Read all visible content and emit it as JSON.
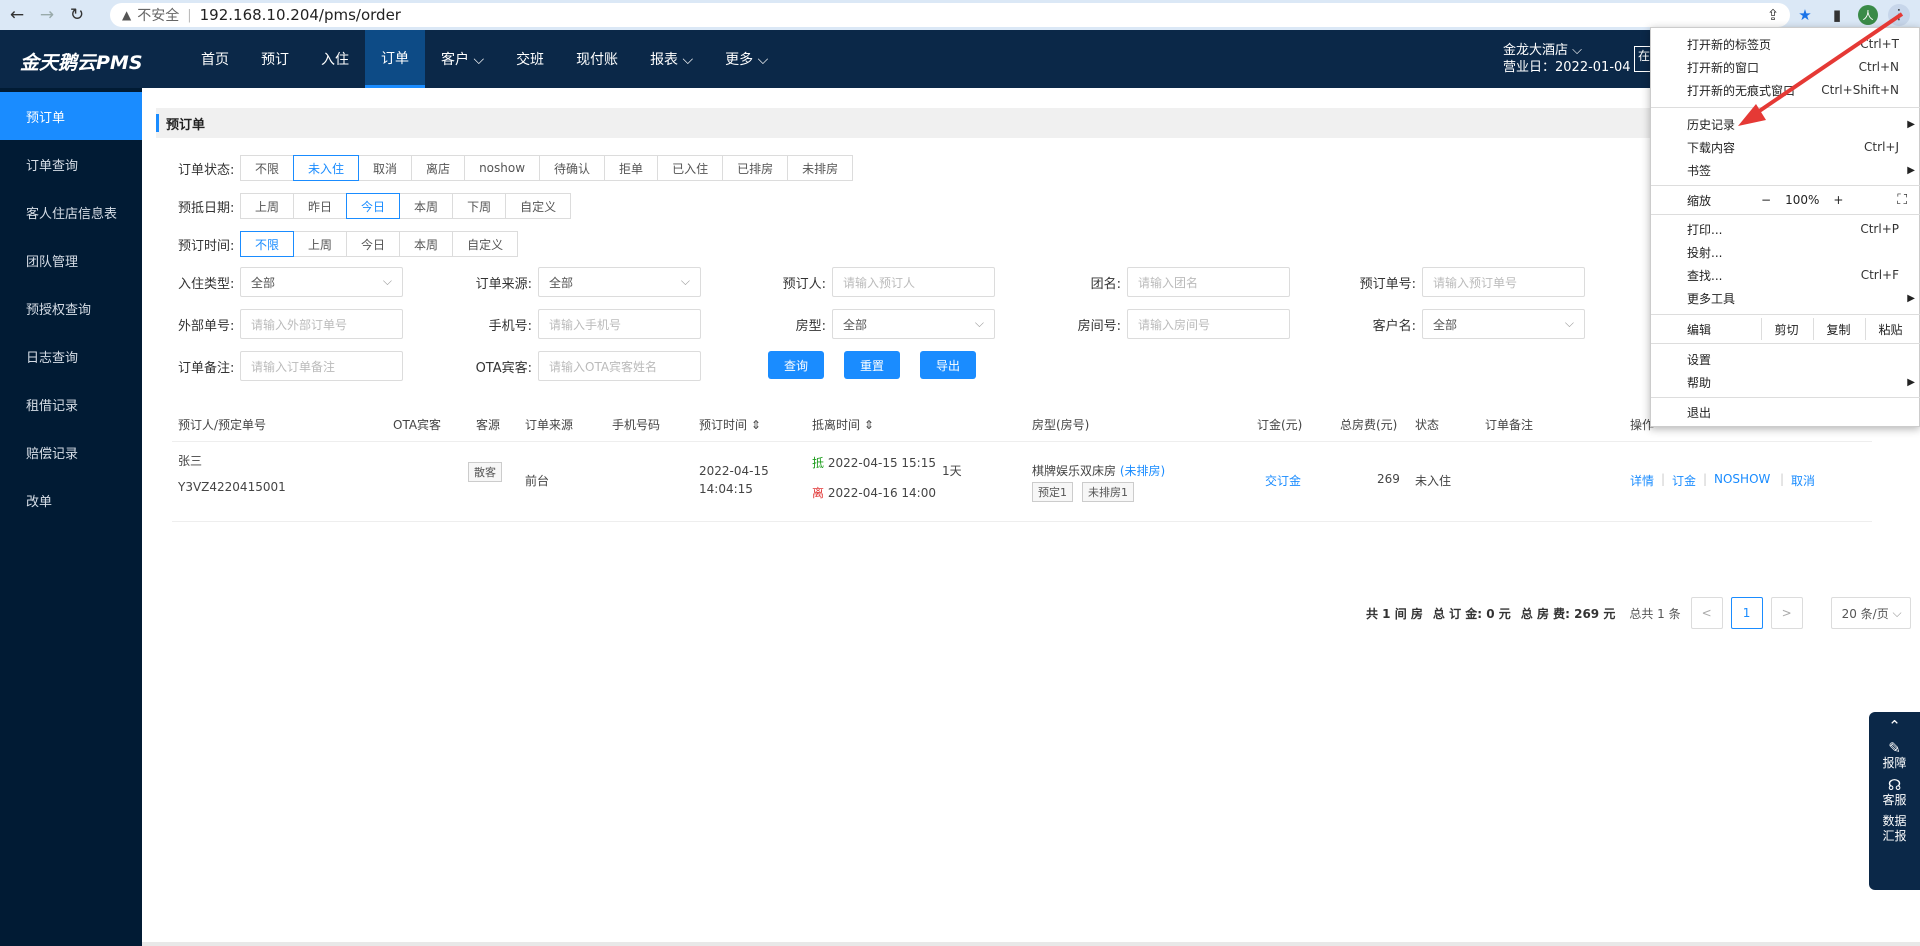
{
  "browser": {
    "insecure_label": "不安全",
    "url": "192.168.10.204/pms/order",
    "avatar": "人"
  },
  "app": {
    "brand": "金天鹅云PMS",
    "nav": [
      {
        "label": "首页"
      },
      {
        "label": "预订"
      },
      {
        "label": "入住"
      },
      {
        "label": "订单"
      },
      {
        "label": "客户 ⌵"
      },
      {
        "label": "交班"
      },
      {
        "label": "现付账"
      },
      {
        "label": "报表 ⌵"
      },
      {
        "label": "更多 ⌵"
      }
    ],
    "hotel_name": "金龙大酒店 ⌵",
    "business_date": "营业日：2022-01-04",
    "top_btn": "在"
  },
  "sidebar": [
    {
      "label": "预订单"
    },
    {
      "label": "订单查询"
    },
    {
      "label": "客人住店信息表"
    },
    {
      "label": "团队管理"
    },
    {
      "label": "预授权查询"
    },
    {
      "label": "日志查询"
    },
    {
      "label": "租借记录"
    },
    {
      "label": "赔偿记录"
    },
    {
      "label": "改单"
    }
  ],
  "page": {
    "title": "预订单",
    "filters": {
      "status_label": "订单状态:",
      "status_options": [
        "不限",
        "未入住",
        "取消",
        "离店",
        "noshow",
        "待确认",
        "拒单",
        "已入住",
        "已排房",
        "未排房"
      ],
      "arrival_label": "预抵日期:",
      "arrival_options": [
        "上周",
        "昨日",
        "今日",
        "本周",
        "下周",
        "自定义"
      ],
      "booking_label": "预订时间:",
      "booking_options": [
        "不限",
        "上周",
        "今日",
        "本周",
        "自定义"
      ]
    },
    "fields": {
      "checkin_type": {
        "label": "入住类型:",
        "value": "全部"
      },
      "order_source": {
        "label": "订单来源:",
        "value": "全部"
      },
      "booker": {
        "label": "预订人:",
        "placeholder": "请输入预订人"
      },
      "group": {
        "label": "团名:",
        "placeholder": "请输入团名"
      },
      "order_no": {
        "label": "预订单号:",
        "placeholder": "请输入预订单号"
      },
      "external_no": {
        "label": "外部单号:",
        "placeholder": "请输入外部订单号"
      },
      "phone": {
        "label": "手机号:",
        "placeholder": "请输入手机号"
      },
      "room_type": {
        "label": "房型:",
        "value": "全部"
      },
      "room_no": {
        "label": "房间号:",
        "placeholder": "请输入房间号"
      },
      "customer": {
        "label": "客户名:",
        "value": "全部"
      },
      "remark": {
        "label": "订单备注:",
        "placeholder": "请输入订单备注"
      },
      "ota_guest": {
        "label": "OTA宾客:",
        "placeholder": "请输入OTA宾客姓名"
      }
    },
    "buttons": {
      "query": "查询",
      "reset": "重置",
      "export": "导出"
    },
    "table": {
      "headers": [
        "预订人/预定单号",
        "OTA宾客",
        "客源",
        "订单来源",
        "手机号码",
        "预订时间 ⇕",
        "抵离时间 ⇕",
        "房型(房号)",
        "订金(元)",
        "总房费(元)",
        "状态",
        "订单备注",
        "操作"
      ],
      "rows": [
        {
          "booker": "张三",
          "order_no": "Y3VZ4220415001",
          "source_tag": "散客",
          "channel": "前台",
          "booked_date": "2022-04-15",
          "booked_time": "14:04:15",
          "arrive_mark": "抵",
          "arrive": "2022-04-15 15:15",
          "nights": "1天",
          "leave_mark": "离",
          "leave": "2022-04-16 14:00",
          "room_type": "棋牌娱乐双床房",
          "room_status": "(未排房)",
          "tag1": "预定1",
          "tag2": "未排房1",
          "deposit": "交订金",
          "total": "269",
          "status": "未入住",
          "actions": [
            "详情",
            "订金",
            "NOSHOW",
            "取消"
          ]
        }
      ]
    },
    "summary": {
      "rooms": "共 1 间 房",
      "deposit": "总 订 金: 0 元",
      "total": "总 房 费: 269 元",
      "count": "总共 1 条",
      "prev": "<",
      "page": "1",
      "next": ">",
      "page_size": "20 条/页"
    }
  },
  "float_panel": {
    "items": [
      "报障",
      "客服",
      "数据\n汇报"
    ]
  },
  "chrome_menu": {
    "new_tab": {
      "label": "打开新的标签页",
      "shortcut": "Ctrl+T"
    },
    "new_window": {
      "label": "打开新的窗口",
      "shortcut": "Ctrl+N"
    },
    "incognito": {
      "label": "打开新的无痕式窗口",
      "shortcut": "Ctrl+Shift+N"
    },
    "history": {
      "label": "历史记录"
    },
    "downloads": {
      "label": "下载内容",
      "shortcut": "Ctrl+J"
    },
    "bookmarks": {
      "label": "书签"
    },
    "zoom": {
      "label": "缩放",
      "minus": "−",
      "value": "100%",
      "plus": "+"
    },
    "print": {
      "label": "打印...",
      "shortcut": "Ctrl+P"
    },
    "cast": {
      "label": "投射..."
    },
    "find": {
      "label": "查找...",
      "shortcut": "Ctrl+F"
    },
    "more_tools": {
      "label": "更多工具"
    },
    "edit": {
      "label": "编辑",
      "cut": "剪切",
      "copy": "复制",
      "paste": "粘贴"
    },
    "settings": {
      "label": "设置"
    },
    "help": {
      "label": "帮助"
    },
    "exit": {
      "label": "退出"
    }
  },
  "colors": {
    "accent": "#1a8cff",
    "topbar": "#0b2848",
    "sidebar": "#011b34",
    "annotation_arrow": "#e53935"
  }
}
